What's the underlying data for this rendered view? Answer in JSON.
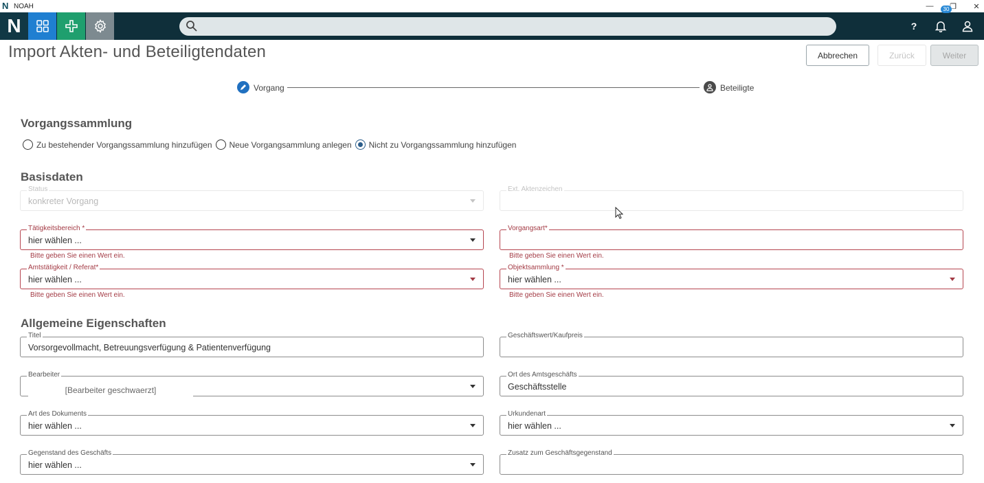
{
  "window": {
    "title": "NOAH",
    "minimize": "—",
    "restore": "❐",
    "close": "✕"
  },
  "appbar": {
    "brand": "N",
    "search_placeholder": "",
    "help": "?",
    "notifications_count": "30"
  },
  "page": {
    "title": "Import Akten- und Beteiligtendaten",
    "buttons": {
      "cancel": "Abbrechen",
      "back": "Zurück",
      "next": "Weiter"
    }
  },
  "stepper": {
    "step1": "Vorgang",
    "step2": "Beteiligte"
  },
  "collection": {
    "title": "Vorgangssammlung",
    "options": [
      "Zu bestehender Vorgangssammlung hinzufügen",
      "Neue Vorgangsammlung anlegen",
      "Nicht zu Vorgangssammlung hinzufügen"
    ],
    "selected_index": 2
  },
  "basis": {
    "title": "Basisdaten",
    "status_label": "Status",
    "status_value": "konkreter Vorgang",
    "ext_label": "Ext. Aktenzeichen",
    "ext_value": "",
    "taetigkeit_label": "Tätigkeitsbereich *",
    "taetigkeit_value": "hier wählen ...",
    "vorgangsart_label": "Vorgangsart*",
    "vorgangsart_value": "",
    "amt_label": "Amtstätigkeit / Referat*",
    "amt_value": "hier wählen ...",
    "objekt_label": "Objektsammlung *",
    "objekt_value": "hier wählen ...",
    "error_text": "Bitte geben Sie einen Wert ein."
  },
  "general": {
    "title": "Allgemeine Eigenschaften",
    "titel_label": "Titel",
    "titel_value": "Vorsorgevollmacht, Betreuungsverfügung & Patientenverfügung",
    "wert_label": "Geschäftswert/Kaufpreis",
    "wert_value": "",
    "bearbeiter_label": "Bearbeiter",
    "bearbeiter_value": "[Bearbeiter geschwaerzt]",
    "ort_label": "Ort des Amtsgeschäfts",
    "ort_value": "Geschäftsstelle",
    "dokart_label": "Art des Dokuments",
    "dokart_value": "hier wählen ...",
    "urkundenart_label": "Urkundenart",
    "urkundenart_value": "hier wählen ...",
    "gegenstand_label": "Gegenstand des Geschäfts",
    "gegenstand_value": "hier wählen ...",
    "zusatz_label": "Zusatz zum Geschäftsgegenstand",
    "zusatz_value": ""
  }
}
